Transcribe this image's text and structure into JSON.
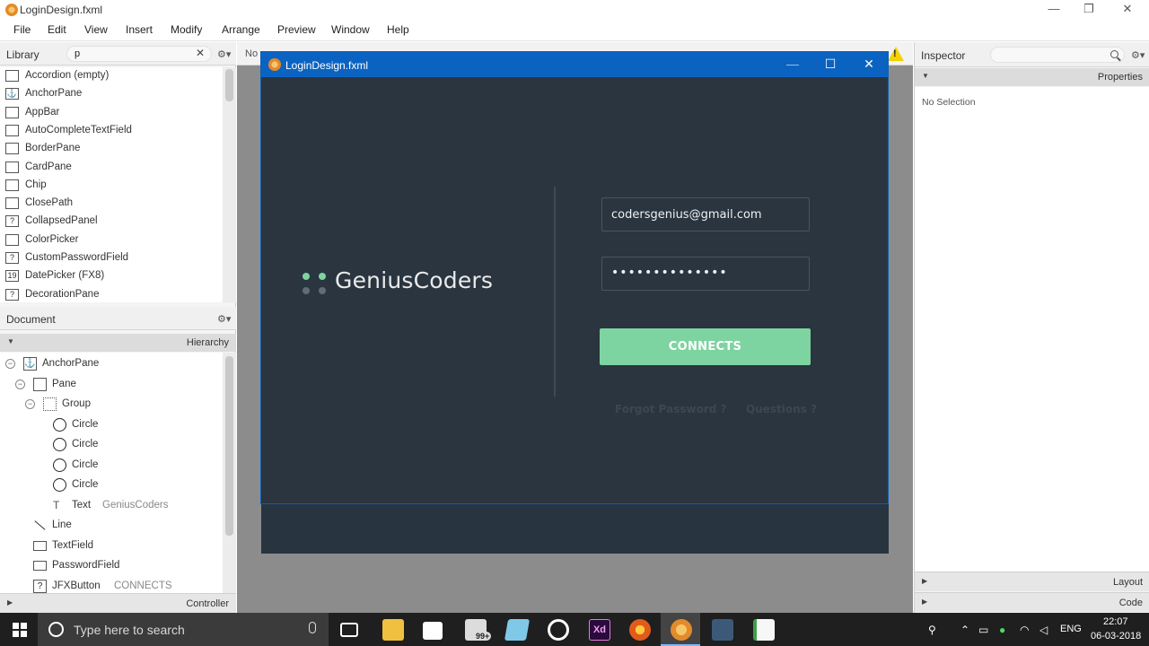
{
  "window": {
    "title": "LoginDesign.fxml",
    "minimize": "—",
    "maximize": "❐",
    "close": "✕"
  },
  "menu": [
    "File",
    "Edit",
    "View",
    "Insert",
    "Modify",
    "Arrange",
    "Preview",
    "Window",
    "Help"
  ],
  "library": {
    "title": "Library",
    "search_value": "p",
    "clear": "✕",
    "gear": "⚙▾",
    "items": [
      {
        "label": "Accordion  (empty)",
        "icon": "accordion-icon",
        "glyph": ""
      },
      {
        "label": "AnchorPane",
        "icon": "anchor-icon",
        "glyph": "⚓"
      },
      {
        "label": "AppBar",
        "icon": "appbar-icon",
        "glyph": ""
      },
      {
        "label": "AutoCompleteTextField",
        "icon": "textfield-icon",
        "glyph": ""
      },
      {
        "label": "BorderPane",
        "icon": "borderpane-icon",
        "glyph": ""
      },
      {
        "label": "CardPane",
        "icon": "cardpane-icon",
        "glyph": ""
      },
      {
        "label": "Chip",
        "icon": "chip-icon",
        "glyph": ""
      },
      {
        "label": "ClosePath",
        "icon": "closepath-icon",
        "glyph": ""
      },
      {
        "label": "CollapsedPanel",
        "icon": "unknown-icon",
        "glyph": "?"
      },
      {
        "label": "ColorPicker",
        "icon": "colorpicker-icon",
        "glyph": ""
      },
      {
        "label": "CustomPasswordField",
        "icon": "unknown-icon",
        "glyph": "?"
      },
      {
        "label": "DatePicker   (FX8)",
        "icon": "datepicker-icon",
        "glyph": "19"
      },
      {
        "label": "DecorationPane",
        "icon": "unknown-icon",
        "glyph": "?"
      }
    ]
  },
  "document": {
    "title": "Document",
    "gear": "⚙▾",
    "hierarchy_label": "Hierarchy",
    "controller_label": "Controller",
    "tree": [
      {
        "label": "AnchorPane",
        "sub": "",
        "level": 0,
        "toggle": "−",
        "icon": "anchor"
      },
      {
        "label": "Pane",
        "sub": "",
        "level": 1,
        "toggle": "−",
        "icon": "box"
      },
      {
        "label": "Group",
        "sub": "",
        "level": 2,
        "toggle": "−",
        "icon": "group"
      },
      {
        "label": "Circle",
        "sub": "",
        "level": 3,
        "toggle": "",
        "icon": "circle"
      },
      {
        "label": "Circle",
        "sub": "",
        "level": 3,
        "toggle": "",
        "icon": "circle"
      },
      {
        "label": "Circle",
        "sub": "",
        "level": 3,
        "toggle": "",
        "icon": "circle"
      },
      {
        "label": "Circle",
        "sub": "",
        "level": 3,
        "toggle": "",
        "icon": "circle"
      },
      {
        "label": "Text",
        "sub": "GeniusCoders",
        "level": 3,
        "toggle": "",
        "icon": "text"
      },
      {
        "label": "Line",
        "sub": "",
        "level": 1,
        "toggle": "",
        "icon": "line"
      },
      {
        "label": "TextField",
        "sub": "",
        "level": 1,
        "toggle": "",
        "icon": "textfield"
      },
      {
        "label": "PasswordField",
        "sub": "",
        "level": 1,
        "toggle": "",
        "icon": "password"
      },
      {
        "label": "JFXButton",
        "sub": "CONNECTS",
        "level": 1,
        "toggle": "",
        "icon": "unknown"
      }
    ]
  },
  "center": {
    "strip_label": "No"
  },
  "preview": {
    "title": "LoginDesign.fxml",
    "minimize": "—",
    "maximize": "☐",
    "close": "✕",
    "brand": "GeniusCoders",
    "dot_colors": [
      "#7dd4a0",
      "#7dd4a0",
      "#5e6e79",
      "#5e6e79"
    ],
    "email_value": "codersgenius@gmail.com",
    "password_value": "••••••••••••••",
    "connect_label": "CONNECTS",
    "forgot_label": "Forgot Password ?",
    "questions_label": "Questions ?",
    "accent": "#7dd4a0",
    "background": "#2a3540"
  },
  "inspector": {
    "title": "Inspector",
    "properties_label": "Properties",
    "no_selection": "No Selection",
    "layout_label": "Layout",
    "code_label": "Code"
  },
  "taskbar": {
    "search_placeholder": "Type here to search",
    "badge": "99+",
    "lang": "ENG",
    "time": "22:07",
    "date": "06-03-2018"
  }
}
